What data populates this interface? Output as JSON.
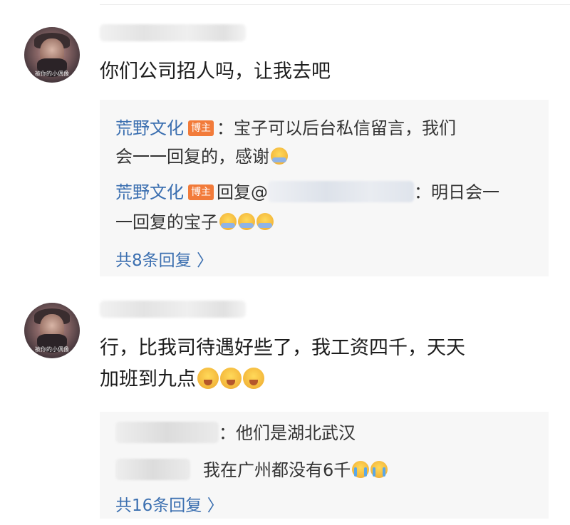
{
  "comments": [
    {
      "avatar_watermark": "被你的小偶像",
      "text_lines": [
        "你们公司招人吗，让我去吧"
      ],
      "replies": [
        {
          "author": "荒野文化",
          "badge": "博主",
          "line1": "：宝子可以后台私信留言，我们",
          "line2": "会一一回复的，感谢",
          "emoji": "hug"
        },
        {
          "author": "荒野文化",
          "badge": "博主",
          "prefix": "回复@",
          "suffix": "：明日会一",
          "line2": "一回复的宝子",
          "emoji": "hug"
        }
      ],
      "more_label": "共8条回复 〉"
    },
    {
      "avatar_watermark": "被你的小偶像",
      "text_lines": [
        "行，比我司待遇好些了，我工资四千，天天",
        "加班到九点"
      ],
      "emoji": "grin",
      "replies": [
        {
          "text": "：他们是湖北武汉"
        },
        {
          "text": "我在广州都没有6千",
          "emoji": "cry"
        }
      ],
      "more_label": "共16条回复 〉"
    }
  ]
}
